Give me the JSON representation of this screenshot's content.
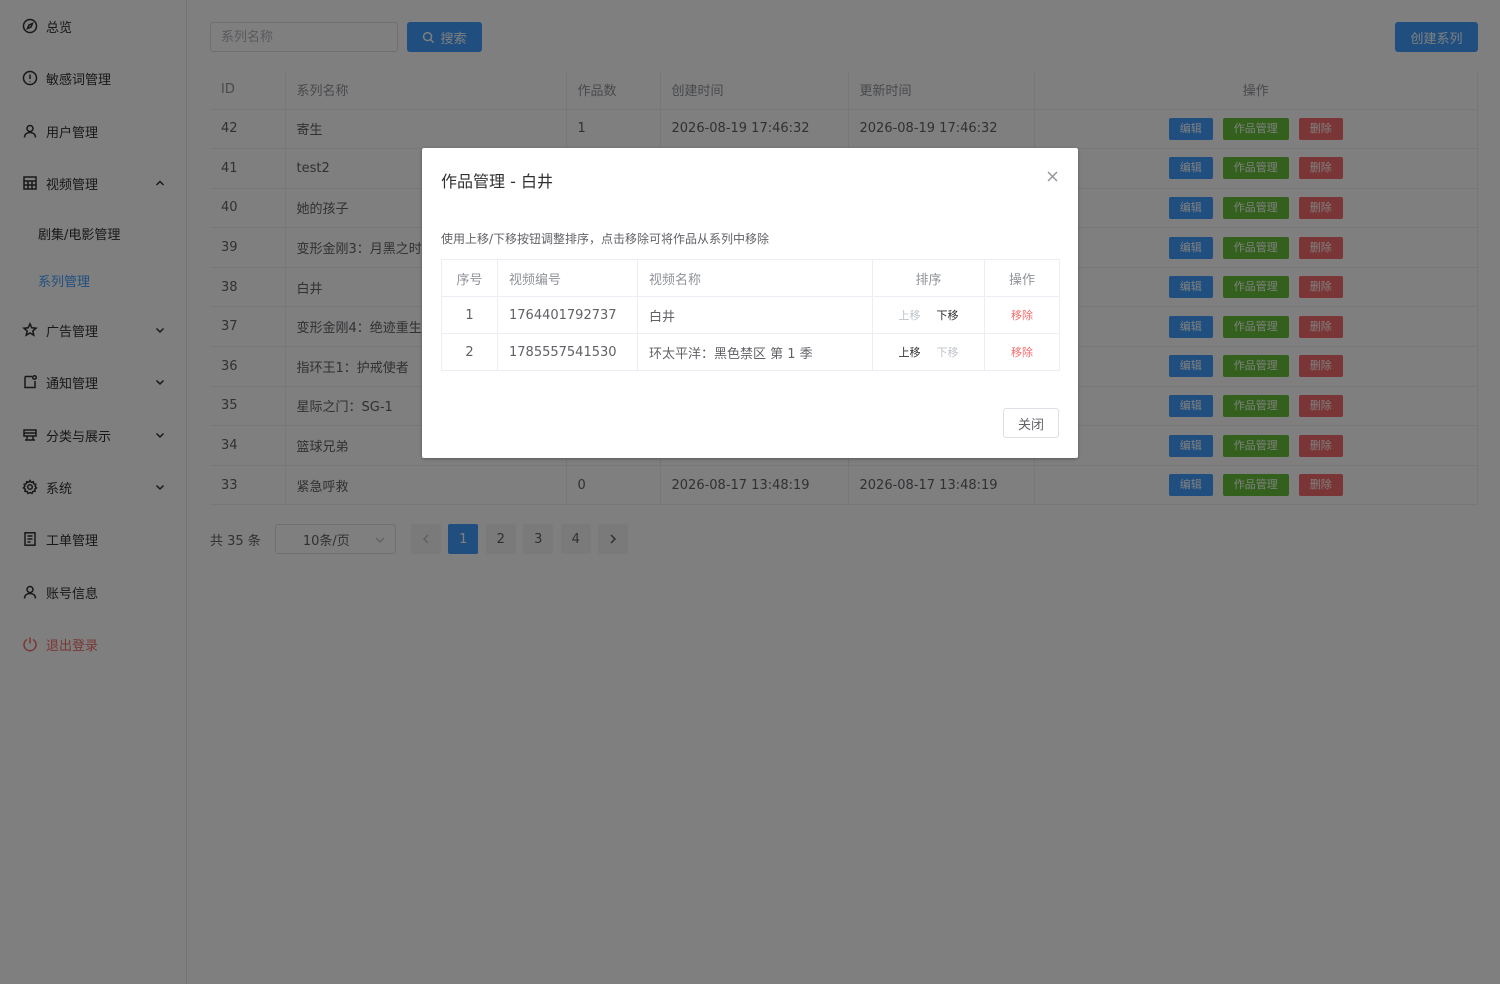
{
  "sidebar": {
    "items": [
      {
        "label": "总览",
        "icon": "compass-icon"
      },
      {
        "label": "敏感词管理",
        "icon": "alert-circle-icon"
      },
      {
        "label": "用户管理",
        "icon": "user-icon"
      },
      {
        "label": "视频管理",
        "icon": "grid-icon"
      },
      {
        "label": "广告管理",
        "icon": "star-icon"
      },
      {
        "label": "通知管理",
        "icon": "bell-icon"
      },
      {
        "label": "分类与展示",
        "icon": "layers-icon"
      },
      {
        "label": "系统",
        "icon": "gear-icon"
      },
      {
        "label": "工单管理",
        "icon": "document-icon"
      },
      {
        "label": "账号信息",
        "icon": "account-icon"
      },
      {
        "label": "退出登录",
        "icon": "power-icon"
      }
    ],
    "subitems": [
      {
        "label": "剧集/电影管理"
      },
      {
        "label": "系列管理"
      }
    ]
  },
  "toolbar": {
    "search_placeholder": "系列名称",
    "search_label": "搜索",
    "create_label": "创建系列"
  },
  "table": {
    "headers": [
      "ID",
      "系列名称",
      "作品数",
      "创建时间",
      "更新时间",
      "操作"
    ],
    "rows": [
      {
        "id": "42",
        "name": "寄生",
        "count": "1",
        "created": "2026-08-19 17:46:32",
        "updated": "2026-08-19 17:46:32"
      },
      {
        "id": "41",
        "name": "test2",
        "count": "",
        "created": "",
        "updated": ""
      },
      {
        "id": "40",
        "name": "她的孩子",
        "count": "",
        "created": "",
        "updated": ""
      },
      {
        "id": "39",
        "name": "变形金刚3：月黑之时",
        "count": "",
        "created": "",
        "updated": ""
      },
      {
        "id": "38",
        "name": "白井",
        "count": "",
        "created": "",
        "updated": ""
      },
      {
        "id": "37",
        "name": "变形金刚4：绝迹重生",
        "count": "",
        "created": "",
        "updated": ""
      },
      {
        "id": "36",
        "name": "指环王1：护戒使者",
        "count": "",
        "created": "",
        "updated": ""
      },
      {
        "id": "35",
        "name": "星际之门：SG-1",
        "count": "",
        "created": "",
        "updated": ""
      },
      {
        "id": "34",
        "name": "篮球兄弟",
        "count": "",
        "created": "",
        "updated": ""
      },
      {
        "id": "33",
        "name": "紧急呼救",
        "count": "0",
        "created": "2026-08-17 13:48:19",
        "updated": "2026-08-17 13:48:19"
      }
    ],
    "actions": {
      "edit": "编辑",
      "works": "作品管理",
      "delete": "删除"
    }
  },
  "pagination": {
    "total": "共 35 条",
    "page_size": "10条/页",
    "pages": [
      "1",
      "2",
      "3",
      "4"
    ],
    "current": "1"
  },
  "dialog": {
    "title": "作品管理 - 白井",
    "hint": "使用上移/下移按钮调整排序，点击移除可将作品从系列中移除",
    "headers": [
      "序号",
      "视频编号",
      "视频名称",
      "排序",
      "操作"
    ],
    "rows": [
      {
        "seq": "1",
        "code": "1764401792737",
        "name": "白井"
      },
      {
        "seq": "2",
        "code": "1785557541530",
        "name": "环太平洋：黑色禁区 第 1 季"
      }
    ],
    "move_up": "上移",
    "move_down": "下移",
    "remove": "移除",
    "close_label": "关闭"
  },
  "colors": {
    "primary": "#409eff",
    "success": "#67c23a",
    "danger": "#f56c6c"
  }
}
